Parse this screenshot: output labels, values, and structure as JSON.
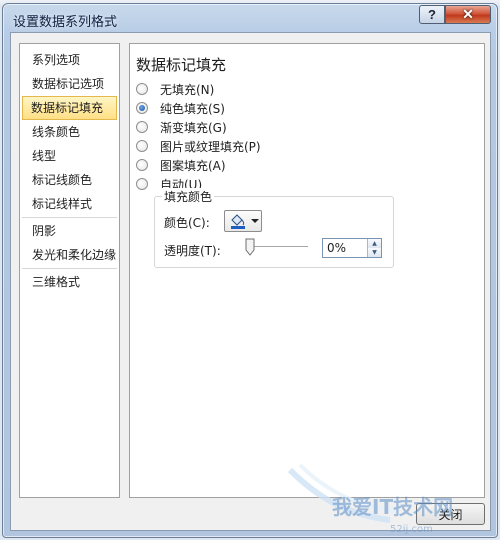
{
  "dialog": {
    "title": "设置数据系列格式",
    "help_label": "?",
    "close_label": "✕"
  },
  "nav": {
    "items": [
      {
        "label": "系列选项"
      },
      {
        "label": "数据标记选项"
      },
      {
        "label": "数据标记填充",
        "selected": true
      },
      {
        "label": "线条颜色"
      },
      {
        "label": "线型"
      },
      {
        "label": "标记线颜色"
      },
      {
        "label": "标记线样式"
      },
      {
        "label": "阴影"
      },
      {
        "label": "发光和柔化边缘"
      },
      {
        "label": "三维格式"
      }
    ]
  },
  "content": {
    "title": "数据标记填充",
    "fill_options": [
      {
        "label": "无填充(N)",
        "checked": false
      },
      {
        "label": "纯色填充(S)",
        "checked": true
      },
      {
        "label": "渐变填充(G)",
        "checked": false
      },
      {
        "label": "图片或纹理填充(P)",
        "checked": false
      },
      {
        "label": "图案填充(A)",
        "checked": false
      },
      {
        "label": "自动(U)",
        "checked": false
      }
    ],
    "fill_color": {
      "group_title": "填充颜色",
      "color_label": "颜色(C):",
      "transparency_label": "透明度(T):",
      "transparency_value": "0%",
      "transparency_percent": 0
    }
  },
  "buttons": {
    "close": "关闭"
  },
  "watermark": {
    "text": "我爱IT技术网",
    "url": "52ij.com"
  },
  "colors": {
    "selection_bg": "#ffe086",
    "accent": "#124c9a",
    "titlebar": "#b8cde6",
    "close_red": "#c0391d"
  }
}
